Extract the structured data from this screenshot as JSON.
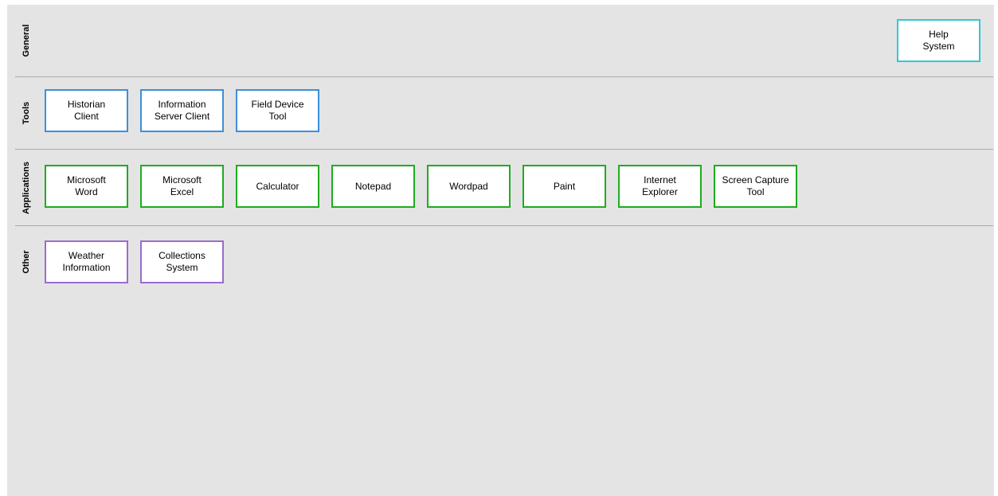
{
  "colors": {
    "panel_background": "#e4e4e4",
    "general_border": "#2fc8d4",
    "tools_border": "#3d8fdb",
    "applications_border": "#1fac1f",
    "other_border": "#9b6bcf",
    "separator": "#a9a9a9"
  },
  "sections": {
    "general": {
      "label": "General",
      "items": [
        "Help\nSystem"
      ]
    },
    "tools": {
      "label": "Tools",
      "items": [
        "Historian\nClient",
        "Information\nServer Client",
        "Field Device\nTool"
      ]
    },
    "applications": {
      "label": "Applications",
      "items": [
        "Microsoft\nWord",
        "Microsoft\nExcel",
        "Calculator",
        "Notepad",
        "Wordpad",
        "Paint",
        "Internet\nExplorer",
        "Screen Capture\nTool"
      ]
    },
    "other": {
      "label": "Other",
      "items": [
        "Weather\nInformation",
        "Collections\nSystem"
      ]
    }
  }
}
